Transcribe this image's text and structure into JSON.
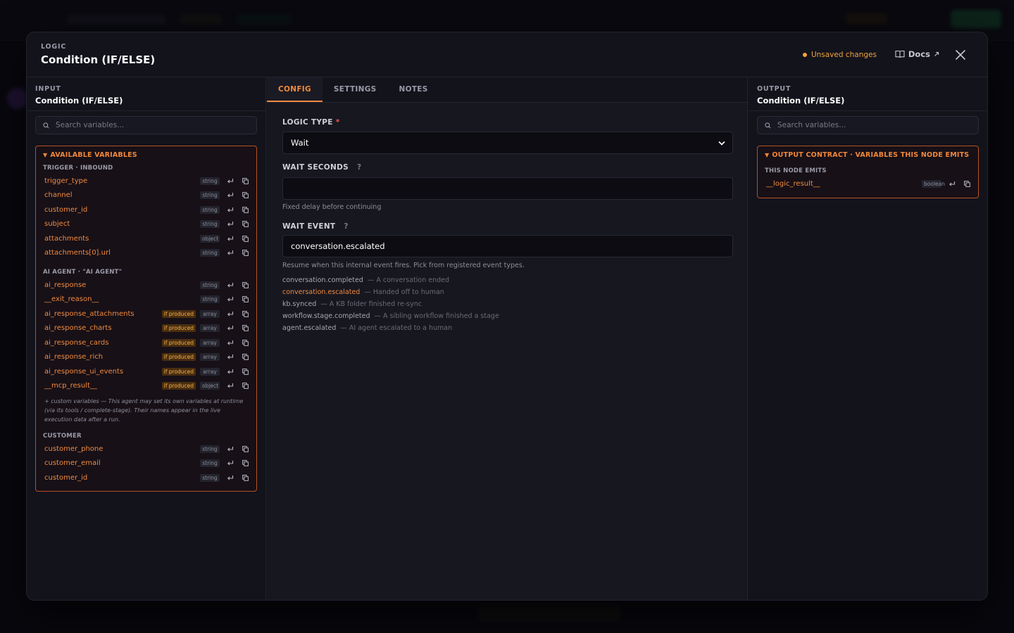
{
  "modal": {
    "eyebrow": "LOGIC",
    "title": "Condition (IF/ELSE)",
    "unsaved": "Unsaved changes",
    "docs_label": "Docs"
  },
  "input_panel": {
    "eyebrow": "INPUT",
    "subtitle": "Condition (IF/ELSE)",
    "search_placeholder": "Search variables...",
    "box_title": "AVAILABLE VARIABLES",
    "groups": [
      {
        "label": "TRIGGER · INBOUND",
        "vars": [
          {
            "name": "trigger_type",
            "type": "string"
          },
          {
            "name": "channel",
            "type": "string"
          },
          {
            "name": "customer_id",
            "type": "string"
          },
          {
            "name": "subject",
            "type": "string"
          },
          {
            "name": "attachments",
            "type": "object"
          },
          {
            "name": "attachments[0].url",
            "type": "string"
          }
        ]
      },
      {
        "label": "AI AGENT · \"AI AGENT\"",
        "vars": [
          {
            "name": "ai_response",
            "type": "string"
          },
          {
            "name": "__exit_reason__",
            "type": "string"
          },
          {
            "name": "ai_response_attachments",
            "badge": "if produced",
            "type": "array"
          },
          {
            "name": "ai_response_charts",
            "badge": "if produced",
            "type": "array"
          },
          {
            "name": "ai_response_cards",
            "badge": "if produced",
            "type": "array"
          },
          {
            "name": "ai_response_rich",
            "badge": "if produced",
            "type": "array"
          },
          {
            "name": "ai_response_ui_events",
            "badge": "if produced",
            "type": "array"
          },
          {
            "name": "__mcp_result__",
            "badge": "if produced",
            "type": "object"
          }
        ],
        "note": "+ custom variables — This agent may set its own variables at runtime (via its tools / complete-stage). Their names appear in the live execution data after a run."
      },
      {
        "label": "CUSTOMER",
        "vars": [
          {
            "name": "customer_phone",
            "type": "string"
          },
          {
            "name": "customer_email",
            "type": "string"
          },
          {
            "name": "customer_id",
            "type": "string"
          }
        ]
      }
    ]
  },
  "config_panel": {
    "tabs": [
      "CONFIG",
      "SETTINGS",
      "NOTES"
    ],
    "active_tab": "CONFIG",
    "logic_type_label": "LOGIC TYPE",
    "logic_type_value": "Wait",
    "wait_seconds_label": "WAIT SECONDS",
    "wait_seconds_value": "",
    "wait_seconds_hint": "Fixed delay before continuing",
    "wait_event_label": "WAIT EVENT",
    "wait_event_value": "conversation.escalated",
    "wait_event_hint": "Resume when this internal event fires. Pick from registered event types.",
    "help_glyph": "?",
    "events": [
      {
        "name": "conversation.completed",
        "desc": "— A conversation ended"
      },
      {
        "name": "conversation.escalated",
        "desc": "— Handed off to human",
        "selected": true
      },
      {
        "name": "kb.synced",
        "desc": "— A KB folder finished re-sync"
      },
      {
        "name": "workflow.stage.completed",
        "desc": "— A sibling workflow finished a stage"
      },
      {
        "name": "agent.escalated",
        "desc": "— AI agent escalated to a human"
      }
    ]
  },
  "output_panel": {
    "eyebrow": "OUTPUT",
    "subtitle": "Condition (IF/ELSE)",
    "search_placeholder": "Search variables...",
    "box_title": "OUTPUT CONTRACT · VARIABLES THIS NODE EMITS",
    "group_label": "THIS NODE EMITS",
    "vars": [
      {
        "name": "__logic_result__",
        "type": "boolean"
      }
    ]
  },
  "colors": {
    "accent": "#f08a3e",
    "warning": "#f0a33c",
    "required": "#ff4d4d",
    "panel_bg": "#13131c"
  }
}
